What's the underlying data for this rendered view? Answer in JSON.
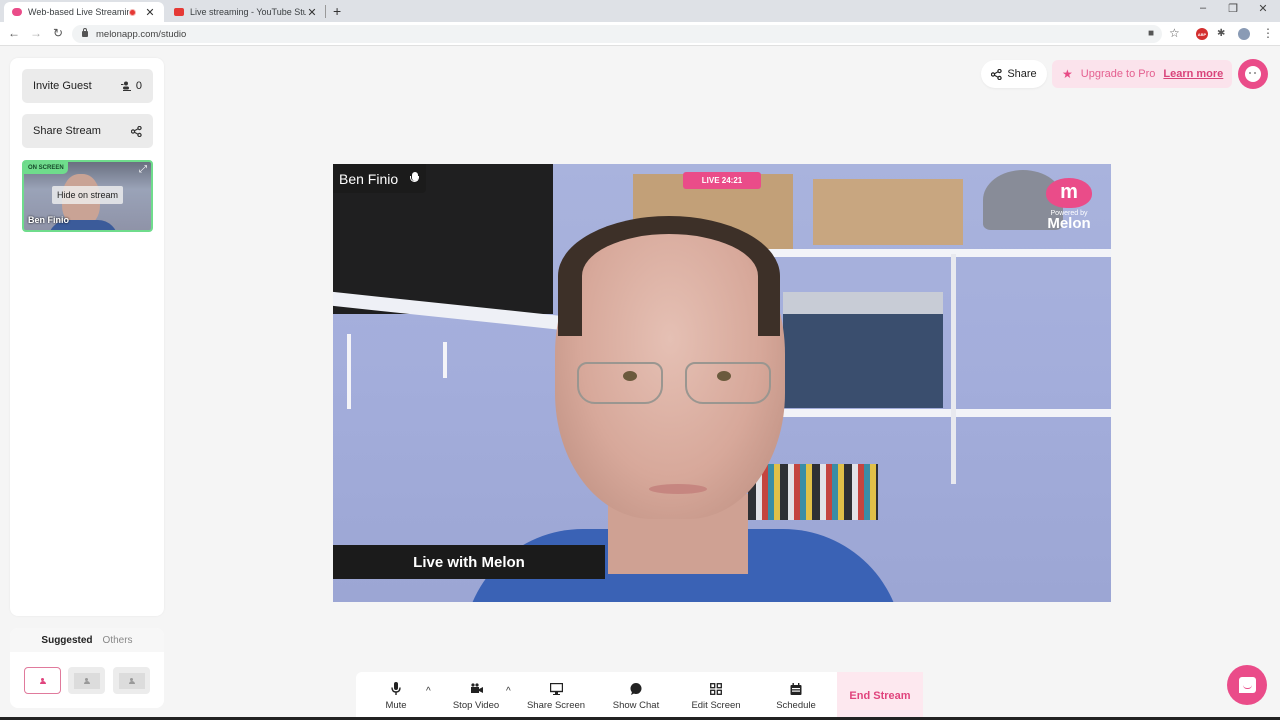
{
  "browser": {
    "tabs": [
      {
        "title": "Web-based Live Streaming S",
        "favicon": "melon-icon",
        "recording": true,
        "active": true
      },
      {
        "title": "Live streaming - YouTube Studio",
        "favicon": "youtube-icon",
        "active": false
      }
    ],
    "close_glyph": "✕",
    "new_tab_glyph": "+",
    "url": "melonapp.com/studio",
    "window_controls": {
      "minimize": "–",
      "restore": "❐",
      "close": "✕"
    },
    "nav": {
      "back": "←",
      "forward": "→",
      "reload": "↻"
    },
    "extensions": {
      "camera": "■",
      "bookmark": "☆",
      "adblock": "ABP",
      "puzzle": "✱",
      "menu": "⋮"
    }
  },
  "sidebar": {
    "invite_guest": {
      "label": "Invite Guest",
      "count": "0"
    },
    "share_stream": {
      "label": "Share Stream"
    },
    "participant": {
      "status": "ON SCREEN",
      "hover_action": "Hide on stream",
      "name": "Ben Finio",
      "expand_glyph": "⤢"
    }
  },
  "layouts": {
    "tabs": [
      {
        "label": "Suggested",
        "active": true
      },
      {
        "label": "Others",
        "active": false
      }
    ],
    "options": [
      {
        "name": "solo",
        "active": true
      },
      {
        "name": "boxed",
        "active": false
      },
      {
        "name": "boxed-alt",
        "active": false
      }
    ]
  },
  "header": {
    "share_label": "Share",
    "upgrade_label": "Upgrade to Pro",
    "learn_more_label": "Learn more",
    "star_glyph": "★"
  },
  "stage": {
    "speaker_name": "Ben Finio",
    "live_badge": "LIVE 24:21",
    "logo": {
      "glyph": "m",
      "powered_by": "Powered by",
      "brand": "Melon"
    },
    "banner_text": "Live with Melon"
  },
  "toolbar": {
    "items": [
      {
        "label": "Mute",
        "icon": "microphone-icon"
      },
      {
        "label": "Stop Video",
        "icon": "video-camera-icon"
      },
      {
        "label": "Share Screen",
        "icon": "monitor-icon"
      },
      {
        "label": "Show Chat",
        "icon": "chat-bubble-icon"
      },
      {
        "label": "Edit Screen",
        "icon": "layout-grid-icon"
      },
      {
        "label": "Schedule",
        "icon": "calendar-icon"
      }
    ],
    "caret_glyph": "^",
    "end_stream_label": "End Stream"
  },
  "colors": {
    "brand_pink": "#ea4c89",
    "on_screen_green": "#6fdc8c",
    "end_stream_bg": "#fde8ef"
  }
}
